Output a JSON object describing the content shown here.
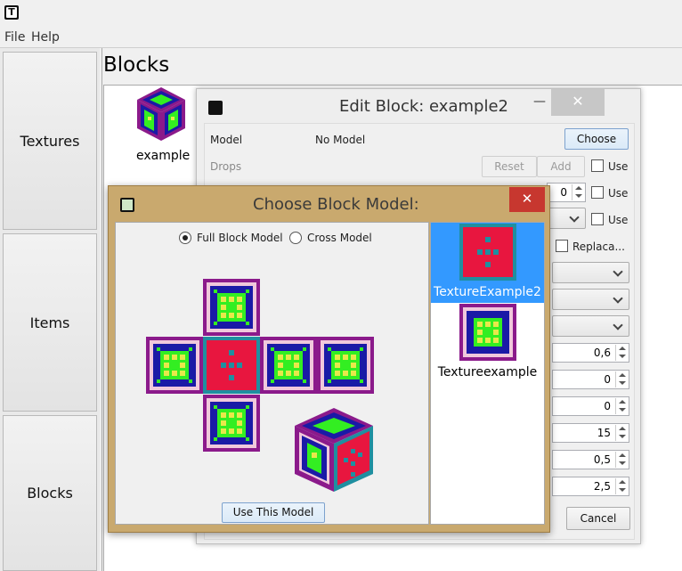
{
  "menu": {
    "file": "File",
    "help": "Help"
  },
  "sidebar": {
    "items": [
      {
        "label": "Textures"
      },
      {
        "label": "Items"
      },
      {
        "label": "Blocks"
      }
    ]
  },
  "blocks_page": {
    "title": "Blocks",
    "block_label": "example"
  },
  "edit_dialog": {
    "title": "Edit Block: example2",
    "model_label": "Model",
    "model_value": "No Model",
    "choose_button": "Choose",
    "drops_label": "Drops",
    "reset_button": "Reset",
    "add_button": "Add",
    "use_label": "Use",
    "spin_drop_value": "0",
    "replace_label": "Replaca...",
    "values": [
      "0,6",
      "0",
      "0",
      "15",
      "0,5",
      "2,5"
    ],
    "cancel_button": "Cancel"
  },
  "choose_dialog": {
    "title": "Choose Block Model:",
    "radio_full": "Full Block Model",
    "radio_cross": "Cross Model",
    "selected_model": "Full Block Model",
    "use_button": "Use This Model",
    "textures": [
      {
        "name": "TextureExample2",
        "selected": true
      },
      {
        "name": "Textureexample",
        "selected": false
      }
    ]
  },
  "colors": {
    "selection": "#3399ff",
    "close_red": "#c7372f",
    "choose_frame": "#c9a96e"
  }
}
